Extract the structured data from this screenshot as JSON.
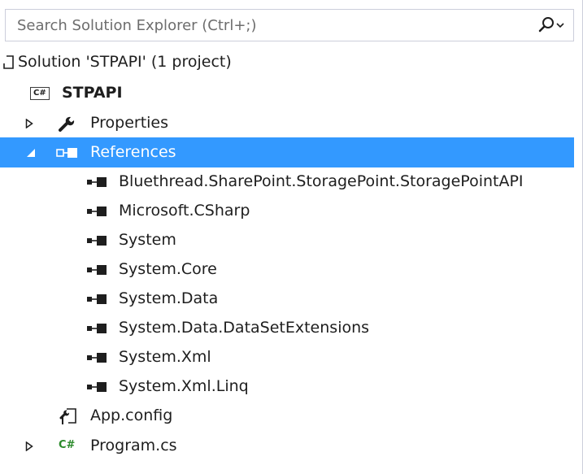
{
  "search": {
    "placeholder": "Search Solution Explorer (Ctrl+;)",
    "icon": "search-icon"
  },
  "tree": {
    "solution": {
      "label": "Solution 'STPAPI' (1 project)",
      "icon": "solution-icon"
    },
    "project": {
      "label": "STPAPI",
      "icon": "csharp-project-icon",
      "badge": "C#"
    },
    "properties": {
      "label": "Properties",
      "icon": "wrench-icon",
      "expanded": false
    },
    "references": {
      "label": "References",
      "icon": "references-icon",
      "expanded": true,
      "selected": true
    },
    "reference_items": [
      {
        "label": "Bluethread.SharePoint.StoragePoint.StoragePointAPI"
      },
      {
        "label": "Microsoft.CSharp"
      },
      {
        "label": "System"
      },
      {
        "label": "System.Core"
      },
      {
        "label": "System.Data"
      },
      {
        "label": "System.Data.DataSetExtensions"
      },
      {
        "label": "System.Xml"
      },
      {
        "label": "System.Xml.Linq"
      }
    ],
    "app_config": {
      "label": "App.config",
      "icon": "config-file-icon"
    },
    "program": {
      "label": "Program.cs",
      "icon": "csharp-file-icon",
      "badge": "C#",
      "expanded": false
    }
  },
  "colors": {
    "selection": "#3399ff",
    "border": "#cccedb",
    "text": "#1e1e1e",
    "csharp_green": "#2a8a2a"
  }
}
